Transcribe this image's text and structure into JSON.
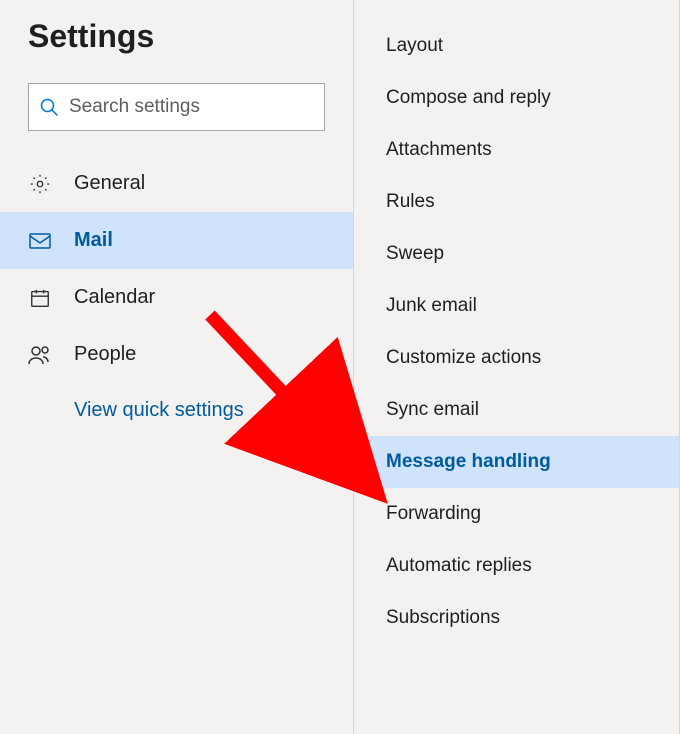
{
  "header": {
    "title": "Settings"
  },
  "search": {
    "placeholder": "Search settings"
  },
  "sidebar": {
    "items": [
      {
        "label": "General",
        "selected": false
      },
      {
        "label": "Mail",
        "selected": true
      },
      {
        "label": "Calendar",
        "selected": false
      },
      {
        "label": "People",
        "selected": false
      }
    ],
    "quick_settings_label": "View quick settings"
  },
  "sub_menu": {
    "items": [
      {
        "label": "Layout",
        "selected": false
      },
      {
        "label": "Compose and reply",
        "selected": false
      },
      {
        "label": "Attachments",
        "selected": false
      },
      {
        "label": "Rules",
        "selected": false
      },
      {
        "label": "Sweep",
        "selected": false
      },
      {
        "label": "Junk email",
        "selected": false
      },
      {
        "label": "Customize actions",
        "selected": false
      },
      {
        "label": "Sync email",
        "selected": false
      },
      {
        "label": "Message handling",
        "selected": true
      },
      {
        "label": "Forwarding",
        "selected": false
      },
      {
        "label": "Automatic replies",
        "selected": false
      },
      {
        "label": "Subscriptions",
        "selected": false
      }
    ]
  },
  "colors": {
    "selected_bg": "#cfe4fa",
    "selected_fg": "#005a9e",
    "annotation": "#ff0000"
  }
}
